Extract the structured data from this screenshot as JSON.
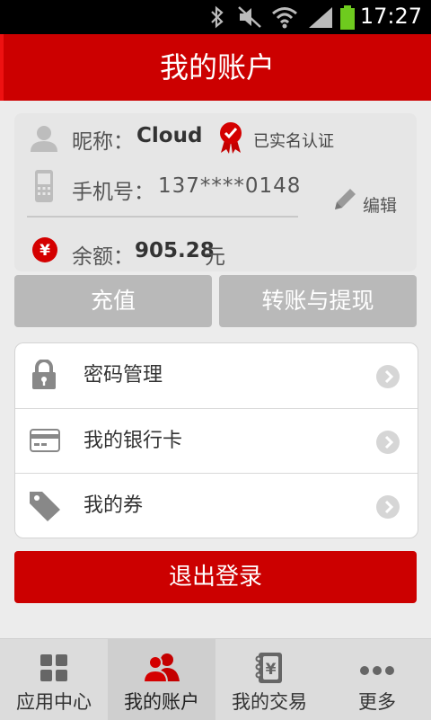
{
  "status_bar": {
    "time": "17:27"
  },
  "header": {
    "title": "我的账户"
  },
  "profile": {
    "nickname_label": "昵称：",
    "nickname": "Cloud",
    "verified_label": "已实名认证",
    "phone_label": "手机号：",
    "phone": "137****0148",
    "edit_label": "编辑",
    "balance_label": "余额：",
    "balance": "905.28",
    "balance_unit": "元",
    "currency_symbol": "¥"
  },
  "actions": {
    "recharge": "充值",
    "transfer": "转账与提现"
  },
  "menu": [
    {
      "label": "密码管理",
      "icon": "lock-icon"
    },
    {
      "label": "我的银行卡",
      "icon": "bank-card-icon"
    },
    {
      "label": "我的券",
      "icon": "coupon-tag-icon"
    }
  ],
  "logout_label": "退出登录",
  "tabs": [
    {
      "label": "应用中心",
      "icon": "app-grid-icon"
    },
    {
      "label": "我的账户",
      "icon": "users-icon",
      "active": true
    },
    {
      "label": "我的交易",
      "icon": "ledger-icon"
    },
    {
      "label": "更多",
      "icon": "more-dots-icon"
    }
  ],
  "colors": {
    "brand_red": "#cc0000",
    "panel_gray": "#e6e6e6",
    "button_gray": "#b9b9b9"
  }
}
